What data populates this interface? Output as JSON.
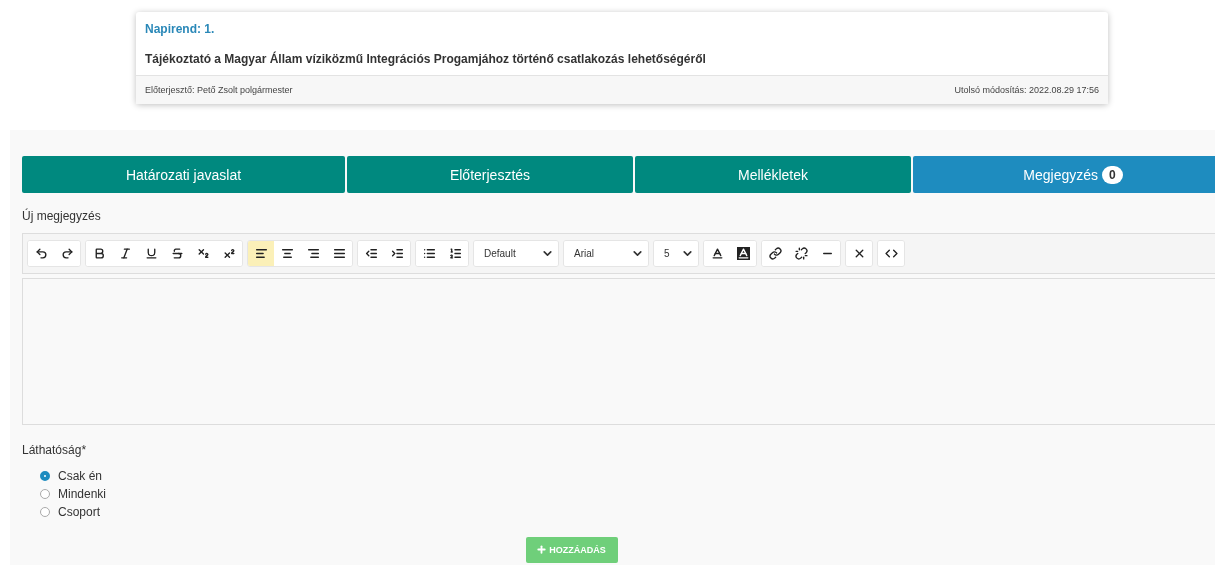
{
  "agenda_card": {
    "heading": "Napirend: 1.",
    "title": "Tájékoztató a Magyar Állam víziközmű Integrációs Progamjához történő csatlakozás lehetőségéről",
    "presenter": "Előterjesztő: Pető Zsolt polgármester",
    "modified": "Utolsó módosítás: 2022.08.29 17:56"
  },
  "tabs": [
    {
      "label": "Határozati javaslat",
      "selected": false
    },
    {
      "label": "Előterjesztés",
      "selected": false
    },
    {
      "label": "Mellékletek",
      "selected": false
    },
    {
      "label": "Megjegyzés",
      "badge": "0",
      "selected": true
    }
  ],
  "editor": {
    "label": "Új megjegyzés",
    "toolbar": [
      [
        {
          "kind": "undo",
          "selected": false
        },
        {
          "kind": "redo",
          "selected": false
        }
      ],
      [
        {
          "kind": "bold",
          "selected": false
        },
        {
          "kind": "italic",
          "selected": false
        },
        {
          "kind": "underline",
          "selected": false
        },
        {
          "kind": "strike",
          "selected": false
        },
        {
          "kind": "subscript",
          "selected": false
        },
        {
          "kind": "superscript",
          "selected": false
        }
      ],
      [
        {
          "kind": "align-left",
          "selected": true
        },
        {
          "kind": "align-center",
          "selected": false
        },
        {
          "kind": "align-right",
          "selected": false
        },
        {
          "kind": "justify",
          "selected": false
        }
      ],
      [
        {
          "kind": "outdent",
          "selected": false
        },
        {
          "kind": "indent",
          "selected": false
        }
      ],
      [
        {
          "kind": "bullet-list",
          "selected": false
        },
        {
          "kind": "numbered-list",
          "selected": false
        }
      ],
      [
        {
          "kind": "select",
          "value": "Default"
        }
      ],
      [
        {
          "kind": "select",
          "value": "Arial"
        }
      ],
      [
        {
          "kind": "select",
          "value": "5"
        }
      ],
      [
        {
          "kind": "text-color",
          "selected": false
        },
        {
          "kind": "highlight",
          "selected": false
        }
      ],
      [
        {
          "kind": "link",
          "selected": false
        },
        {
          "kind": "unlink",
          "selected": false
        },
        {
          "kind": "rule",
          "selected": false
        }
      ],
      [
        {
          "kind": "clear",
          "selected": false
        }
      ],
      [
        {
          "kind": "code",
          "selected": false
        }
      ]
    ]
  },
  "visibility": {
    "label": "Láthatóság*",
    "options": [
      {
        "label": "Csak én",
        "selected": true
      },
      {
        "label": "Mindenki",
        "selected": false
      },
      {
        "label": "Csoport",
        "selected": false
      }
    ]
  },
  "add_button": {
    "label": "HOZZÁADÁS"
  }
}
